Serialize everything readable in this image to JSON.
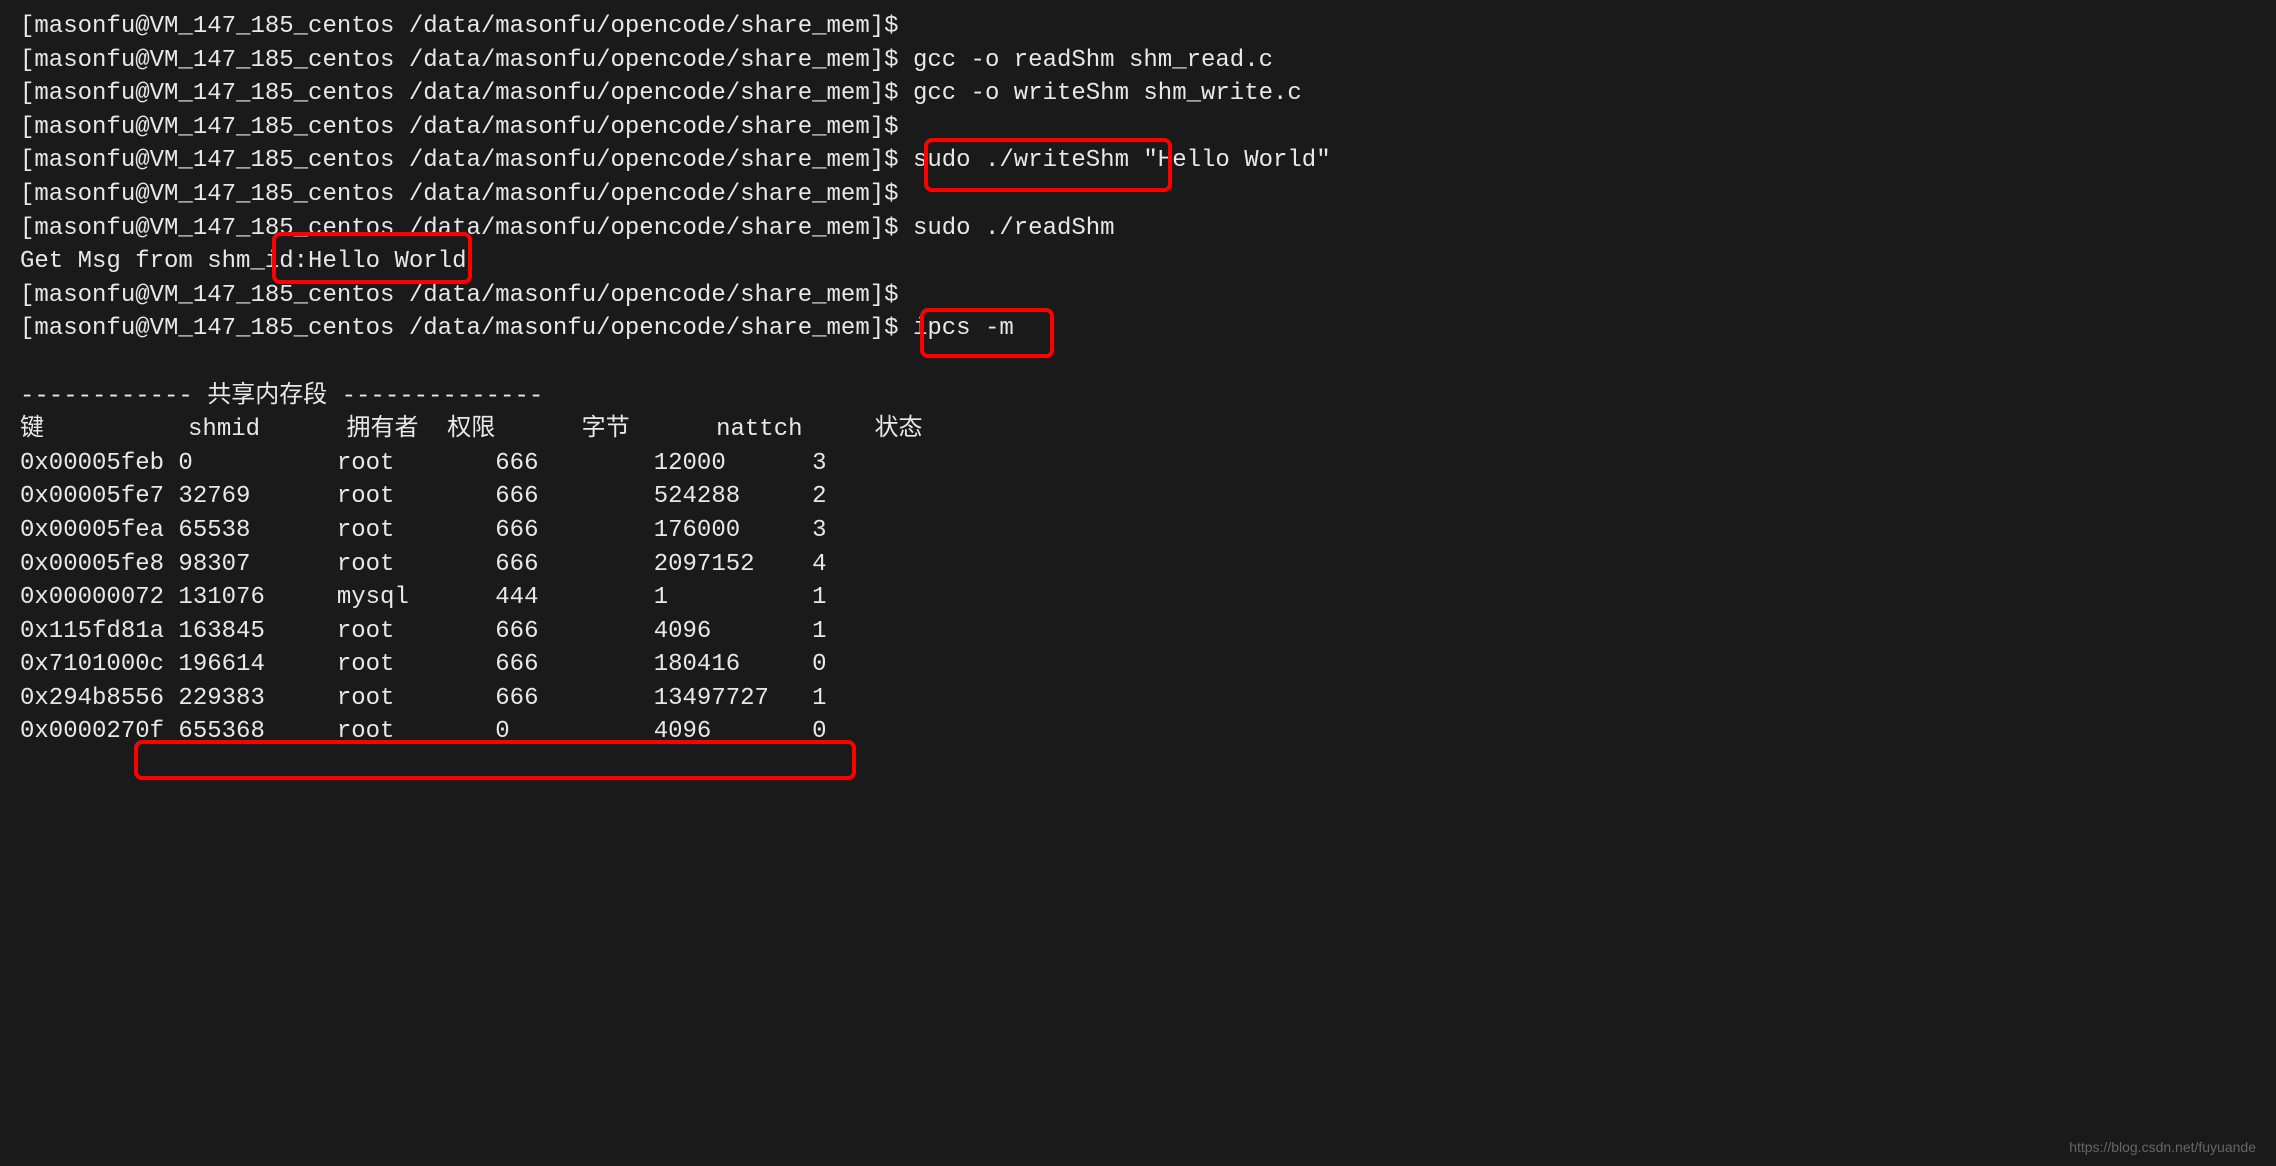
{
  "prompt": "[masonfu@VM_147_185_centos /data/masonfu/opencode/share_mem]$",
  "lines": [
    {
      "prompt": "[masonfu@VM_147_185_centos /data/masonfu/opencode/share_mem]$",
      "cmd": " "
    },
    {
      "prompt": "[masonfu@VM_147_185_centos /data/masonfu/opencode/share_mem]$",
      "cmd": " gcc -o readShm shm_read.c"
    },
    {
      "prompt": "[masonfu@VM_147_185_centos /data/masonfu/opencode/share_mem]$",
      "cmd": " gcc -o writeShm shm_write.c"
    },
    {
      "prompt": "[masonfu@VM_147_185_centos /data/masonfu/opencode/share_mem]$",
      "cmd": " "
    },
    {
      "prompt": "[masonfu@VM_147_185_centos /data/masonfu/opencode/share_mem]$",
      "cmd": " sudo ./writeShm \"Hello World\""
    },
    {
      "prompt": "[masonfu@VM_147_185_centos /data/masonfu/opencode/share_mem]$",
      "cmd": " "
    },
    {
      "prompt": "[masonfu@VM_147_185_centos /data/masonfu/opencode/share_mem]$",
      "cmd": " sudo ./readShm"
    }
  ],
  "output_msg": "Get Msg from shm_id:Hello World",
  "post_lines": [
    {
      "prompt": "[masonfu@VM_147_185_centos /data/masonfu/opencode/share_mem]$",
      "cmd": " "
    },
    {
      "prompt": "[masonfu@VM_147_185_centos /data/masonfu/opencode/share_mem]$",
      "cmd": " ipcs -m"
    }
  ],
  "section_title": "------------ 共享内存段 --------------",
  "table": {
    "headers": [
      "键",
      "shmid",
      "拥有者",
      "权限",
      "字节",
      "nattch",
      "状态"
    ],
    "header_line": "键          shmid      拥有者  权限      字节      nattch     状态",
    "rows": [
      {
        "key": "0x00005feb",
        "shmid": "0",
        "owner": "root",
        "perms": "666",
        "bytes": "12000",
        "nattch": "3",
        "status": ""
      },
      {
        "key": "0x00005fe7",
        "shmid": "32769",
        "owner": "root",
        "perms": "666",
        "bytes": "524288",
        "nattch": "2",
        "status": ""
      },
      {
        "key": "0x00005fea",
        "shmid": "65538",
        "owner": "root",
        "perms": "666",
        "bytes": "176000",
        "nattch": "3",
        "status": ""
      },
      {
        "key": "0x00005fe8",
        "shmid": "98307",
        "owner": "root",
        "perms": "666",
        "bytes": "2097152",
        "nattch": "4",
        "status": ""
      },
      {
        "key": "0x00000072",
        "shmid": "131076",
        "owner": "mysql",
        "perms": "444",
        "bytes": "1",
        "nattch": "1",
        "status": ""
      },
      {
        "key": "0x115fd81a",
        "shmid": "163845",
        "owner": "root",
        "perms": "666",
        "bytes": "4096",
        "nattch": "1",
        "status": ""
      },
      {
        "key": "0x7101000c",
        "shmid": "196614",
        "owner": "root",
        "perms": "666",
        "bytes": "180416",
        "nattch": "0",
        "status": ""
      },
      {
        "key": "0x294b8556",
        "shmid": "229383",
        "owner": "root",
        "perms": "666",
        "bytes": "13497727",
        "nattch": "1",
        "status": ""
      },
      {
        "key": "0x0000270f",
        "shmid": "655368",
        "owner": "root",
        "perms": "0",
        "bytes": "4096",
        "nattch": "0",
        "status": ""
      }
    ]
  },
  "watermark": "https://blog.csdn.net/fuyuande"
}
